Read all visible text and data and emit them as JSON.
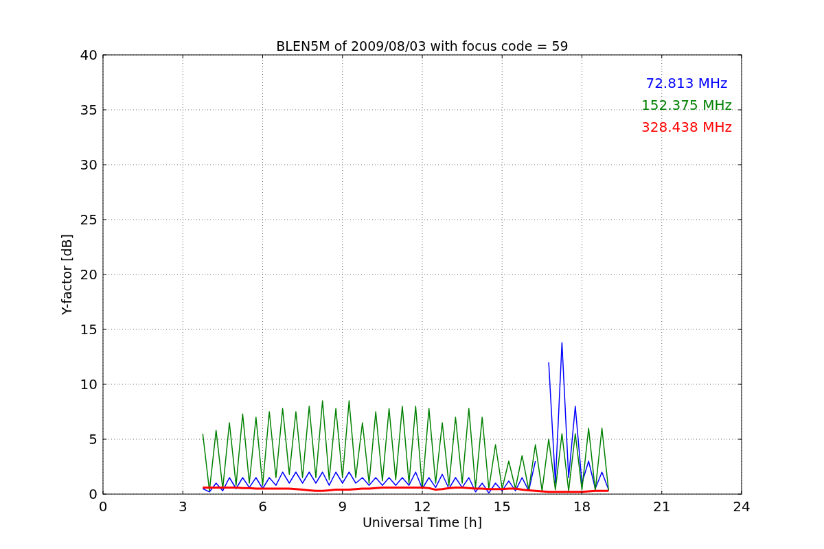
{
  "chart_data": {
    "type": "line",
    "title": "BLEN5M of 2009/08/03 with focus code = 59",
    "xlabel": "Universal Time [h]",
    "ylabel": "Y-factor [dB]",
    "xlim": [
      0,
      24
    ],
    "ylim": [
      0,
      40
    ],
    "xticks": [
      0,
      3,
      6,
      9,
      12,
      15,
      18,
      21,
      24
    ],
    "yticks": [
      0,
      5,
      10,
      15,
      20,
      25,
      30,
      35,
      40
    ],
    "grid": true,
    "x": [
      3.75,
      4,
      4.25,
      4.5,
      4.75,
      5,
      5.25,
      5.5,
      5.75,
      6,
      6.25,
      6.5,
      6.75,
      7,
      7.25,
      7.5,
      7.75,
      8,
      8.25,
      8.5,
      8.75,
      9,
      9.25,
      9.5,
      9.75,
      10,
      10.25,
      10.5,
      10.75,
      11,
      11.25,
      11.5,
      11.75,
      12,
      12.25,
      12.5,
      12.75,
      13,
      13.25,
      13.5,
      13.75,
      14,
      14.25,
      14.5,
      14.75,
      15,
      15.25,
      15.5,
      15.75,
      16,
      16.25,
      16.5,
      16.75,
      17,
      17.25,
      17.5,
      17.75,
      18,
      18.25,
      18.5,
      18.75,
      19
    ],
    "series": [
      {
        "name": "72.813 MHz",
        "color": "#0000ff",
        "values": [
          0.5,
          0.2,
          1,
          0.3,
          1.5,
          0.5,
          1.5,
          0.6,
          1.5,
          0.5,
          1.5,
          0.8,
          2,
          1,
          2,
          1,
          2,
          1,
          2,
          0.8,
          2,
          1,
          2,
          1,
          1.5,
          0.8,
          1.5,
          0.8,
          1.5,
          0.8,
          1.5,
          0.8,
          2,
          0.5,
          1.5,
          0.6,
          1.8,
          0.5,
          1.5,
          0.6,
          1.5,
          0.2,
          1,
          0.1,
          1,
          0.3,
          1.2,
          0.3,
          1.5,
          0.3,
          3,
          null,
          12,
          1,
          13.8,
          1.5,
          8,
          1,
          3,
          0.5,
          2,
          0.4
        ]
      },
      {
        "name": "152.375 MHz",
        "color": "#008000",
        "values": [
          5.5,
          0.3,
          5.8,
          0.5,
          6.5,
          0.8,
          7.3,
          1,
          7,
          0.8,
          7.5,
          1.5,
          7.8,
          1.8,
          7.5,
          1.5,
          8,
          1.5,
          8.5,
          1.3,
          7.8,
          1.5,
          8.5,
          1.5,
          6.5,
          1,
          7.5,
          1.2,
          7.8,
          1.3,
          8,
          1,
          8,
          0.5,
          7.8,
          1,
          6.5,
          0.8,
          7,
          1,
          7.8,
          0.6,
          7,
          0.5,
          4.5,
          0.5,
          3,
          0.5,
          3.5,
          0.4,
          4.5,
          0.3,
          5,
          0.4,
          5.5,
          0.3,
          5.5,
          0.4,
          6,
          0.3,
          6,
          0.3
        ]
      },
      {
        "name": "328.438 MHz",
        "color": "#ff0000",
        "values": [
          0.6,
          0.6,
          0.6,
          0.6,
          0.6,
          0.6,
          0.55,
          0.55,
          0.5,
          0.5,
          0.5,
          0.5,
          0.5,
          0.5,
          0.45,
          0.4,
          0.35,
          0.3,
          0.3,
          0.35,
          0.4,
          0.4,
          0.4,
          0.45,
          0.5,
          0.5,
          0.55,
          0.6,
          0.6,
          0.6,
          0.6,
          0.6,
          0.6,
          0.6,
          0.55,
          0.4,
          0.45,
          0.55,
          0.6,
          0.6,
          0.55,
          0.5,
          0.5,
          0.45,
          0.45,
          0.45,
          0.5,
          0.5,
          0.4,
          0.35,
          0.3,
          0.25,
          0.2,
          0.2,
          0.2,
          0.2,
          0.2,
          0.2,
          0.25,
          0.3,
          0.3,
          0.3
        ]
      }
    ]
  }
}
